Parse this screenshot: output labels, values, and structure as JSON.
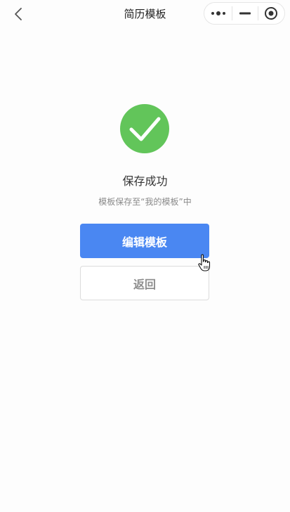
{
  "navbar": {
    "title": "简历模板",
    "back_icon": "chevron-left-icon",
    "capsule": {
      "more_icon": "more-dots-icon",
      "minimize_icon": "minimize-icon",
      "close_icon": "target-circle-icon"
    }
  },
  "result": {
    "icon": "check-circle-icon",
    "icon_color": "#62c55a",
    "title": "保存成功",
    "description": "模板保存至“我的模板”中"
  },
  "actions": {
    "edit_label": "编辑模板",
    "back_label": "返回",
    "primary_color": "#4a87f2"
  }
}
